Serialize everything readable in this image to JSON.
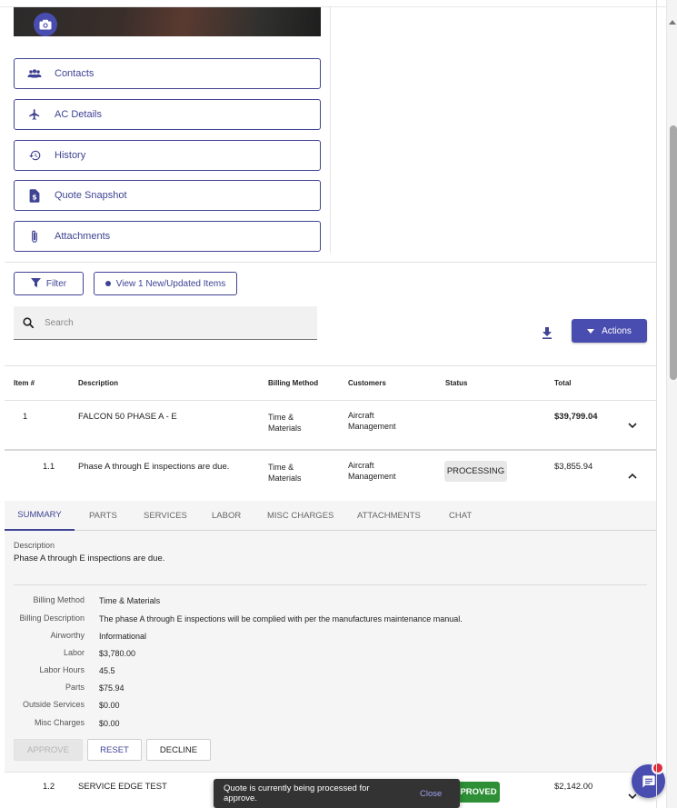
{
  "nav_buttons": [
    {
      "label": "Contacts",
      "icon": "people-icon"
    },
    {
      "label": "AC Details",
      "icon": "airplane-icon"
    },
    {
      "label": "History",
      "icon": "history-icon"
    },
    {
      "label": "Quote Snapshot",
      "icon": "receipt-dollar-icon"
    },
    {
      "label": "Attachments",
      "icon": "paperclip-icon"
    }
  ],
  "toolbar": {
    "filter_label": "Filter",
    "view_updates_label": "View 1 New/Updated Items",
    "search_placeholder": "Search",
    "actions_label": "Actions"
  },
  "table": {
    "headers": [
      "Item #",
      "Description",
      "Billing Method",
      "Customers",
      "Status",
      "Total"
    ],
    "rows": [
      {
        "item": "1",
        "description": "FALCON 50 PHASE A - E",
        "billing_method": "Time & Materials",
        "customer": "Aircraft Management",
        "status": "",
        "total": "$39,799.04"
      },
      {
        "item": "1.1",
        "description": "Phase A through E inspections are due.",
        "billing_method": "Time & Materials",
        "customer": "Aircraft Management",
        "status": "PROCESSING",
        "total": "$3,855.94"
      },
      {
        "item": "1.2",
        "description": "SERVICE EDGE TEST",
        "billing_method": "",
        "customer": "",
        "status": "PROVED",
        "total": "$2,142.00"
      }
    ]
  },
  "tabs": [
    "SUMMARY",
    "PARTS",
    "SERVICES",
    "LABOR",
    "MISC CHARGES",
    "ATTACHMENTS",
    "CHAT"
  ],
  "summary": {
    "description_label": "Description",
    "description_value": "Phase A through E inspections are due.",
    "fields": [
      {
        "label": "Billing Method",
        "value": "Time & Materials"
      },
      {
        "label": "Billing Description",
        "value": "The phase A through E inspections will be complied with per the manufactures maintenance manual."
      },
      {
        "label": "Airworthy",
        "value": "Informational"
      },
      {
        "label": "Labor",
        "value": "$3,780.00"
      },
      {
        "label": "Labor Hours",
        "value": "45.5"
      },
      {
        "label": "Parts",
        "value": "$75.94"
      },
      {
        "label": "Outside Services",
        "value": "$0.00"
      },
      {
        "label": "Misc Charges",
        "value": "$0.00"
      }
    ],
    "approve_label": "APPROVE",
    "reset_label": "RESET",
    "decline_label": "DECLINE"
  },
  "snackbar": {
    "message": "Quote is currently being processed for approve.",
    "close_label": "Close"
  },
  "colors": {
    "primary": "#4a4db0",
    "approved": "#2e8f36",
    "badge": "#e22b3a"
  }
}
